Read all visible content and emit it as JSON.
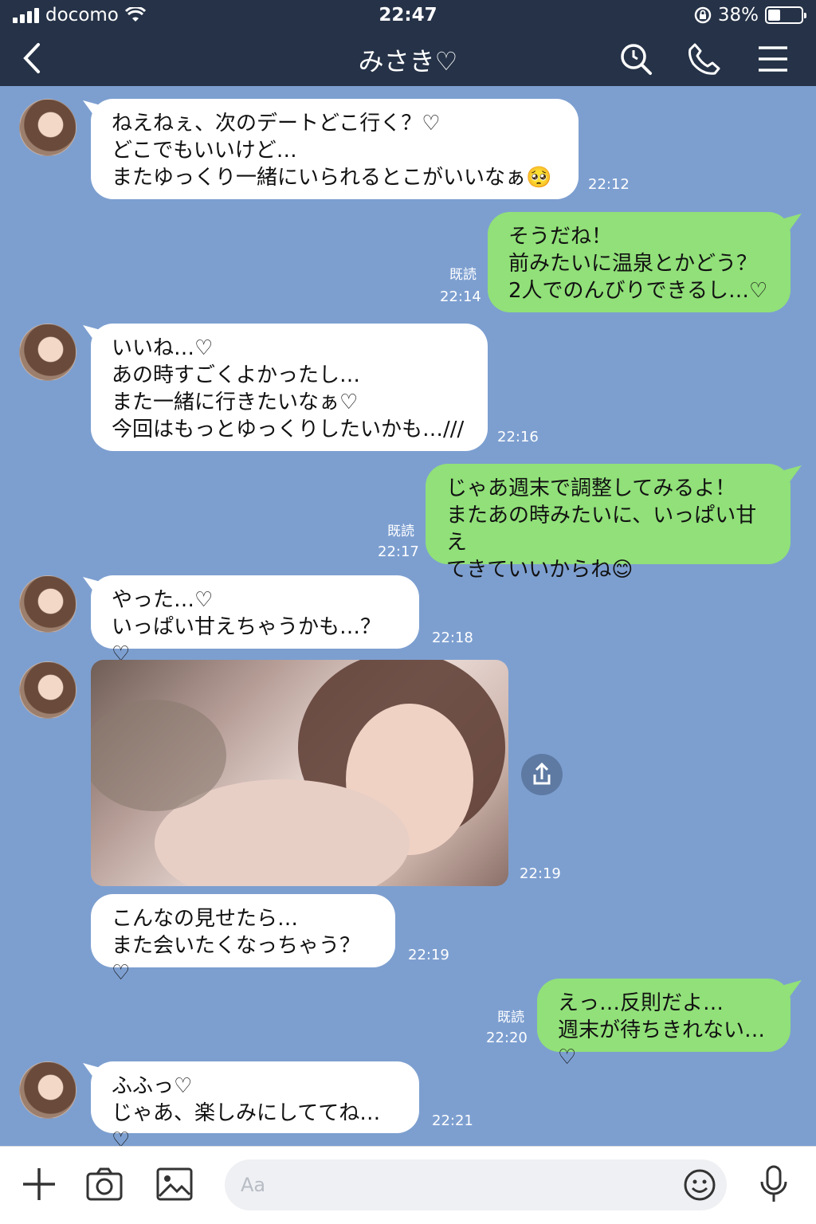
{
  "status": {
    "carrier": "docomo",
    "time": "22:47",
    "battery": "38%",
    "battery_level": 0.38
  },
  "nav": {
    "title": "みさき♡"
  },
  "messages": [
    {
      "text": "ねえねぇ、次のデートどこ行く？♡\nどこでもいいけど…\nまたゆっくり一緒にいられるとこがいいなぁ🥺",
      "time": "22:12"
    },
    {
      "text": "そうだね！\n前みたいに温泉とかどう？\n2人でのんびりできるし…♡",
      "read": "既読",
      "time": "22:14"
    },
    {
      "text": "いいね…♡\nあの時すごくよかったし…\nまた一緒に行きたいなぁ♡\n今回はもっとゆっくりしたいかも…///",
      "time": "22:16"
    },
    {
      "text": "じゃあ週末で調整してみるよ！\nまたあの時みたいに、いっぱい甘え\nてきていいからね😊",
      "read": "既読",
      "time": "22:17"
    },
    {
      "text": "やった…♡\nいっぱい甘えちゃうかも…？♡",
      "time": "22:18"
    },
    {
      "time": "22:19"
    },
    {
      "text": "こんなの見せたら…\nまた会いたくなっちゃう？♡",
      "time": "22:19"
    },
    {
      "text": "えっ…反則だよ…\n週末が待ちきれない…♡",
      "read": "既読",
      "time": "22:20"
    },
    {
      "text": "ふふっ♡\nじゃあ、楽しみにしててね…♡",
      "time": "22:21"
    }
  ],
  "input": {
    "placeholder": "Aa"
  },
  "icons": {
    "back": "chevron-left-icon",
    "search": "search-icon",
    "call": "phone-icon",
    "menu": "hamburger-menu-icon",
    "add": "plus-icon",
    "camera": "camera-icon",
    "gallery": "image-icon",
    "emoji": "emoji-icon",
    "mic": "microphone-icon",
    "share": "share-icon",
    "wifi": "wifi-icon",
    "lock": "rotation-lock-icon"
  },
  "colors": {
    "nav_bg": "#253247",
    "chat_bg": "#7d9fd0",
    "bubble_out": "#91e079",
    "bubble_in": "#ffffff"
  }
}
